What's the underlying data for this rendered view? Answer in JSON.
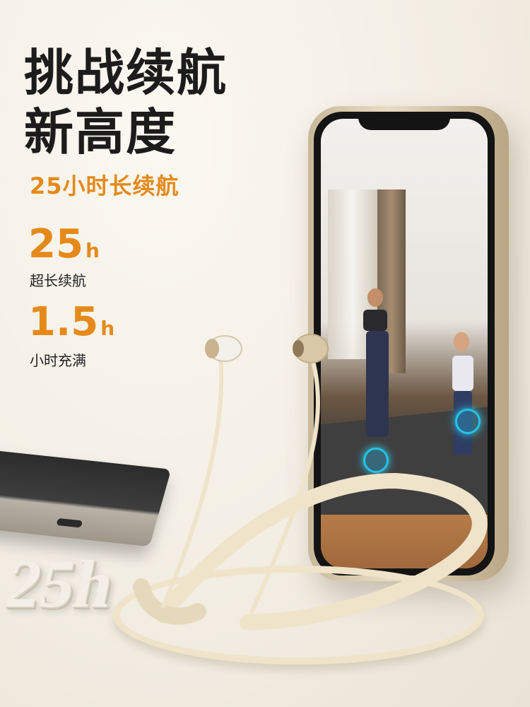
{
  "headline": {
    "line1": "挑战续航",
    "line2": "新高度",
    "subtitle": "25小时长续航"
  },
  "stats": [
    {
      "value": "25",
      "unit": "h",
      "label": "超长续航"
    },
    {
      "value": "1.5",
      "unit": "h",
      "label": "小时充满"
    }
  ],
  "decor_text": "25h",
  "colors": {
    "accent": "#e58a1a",
    "headline": "#1c1c1c",
    "earphone": "#efe3c9"
  }
}
